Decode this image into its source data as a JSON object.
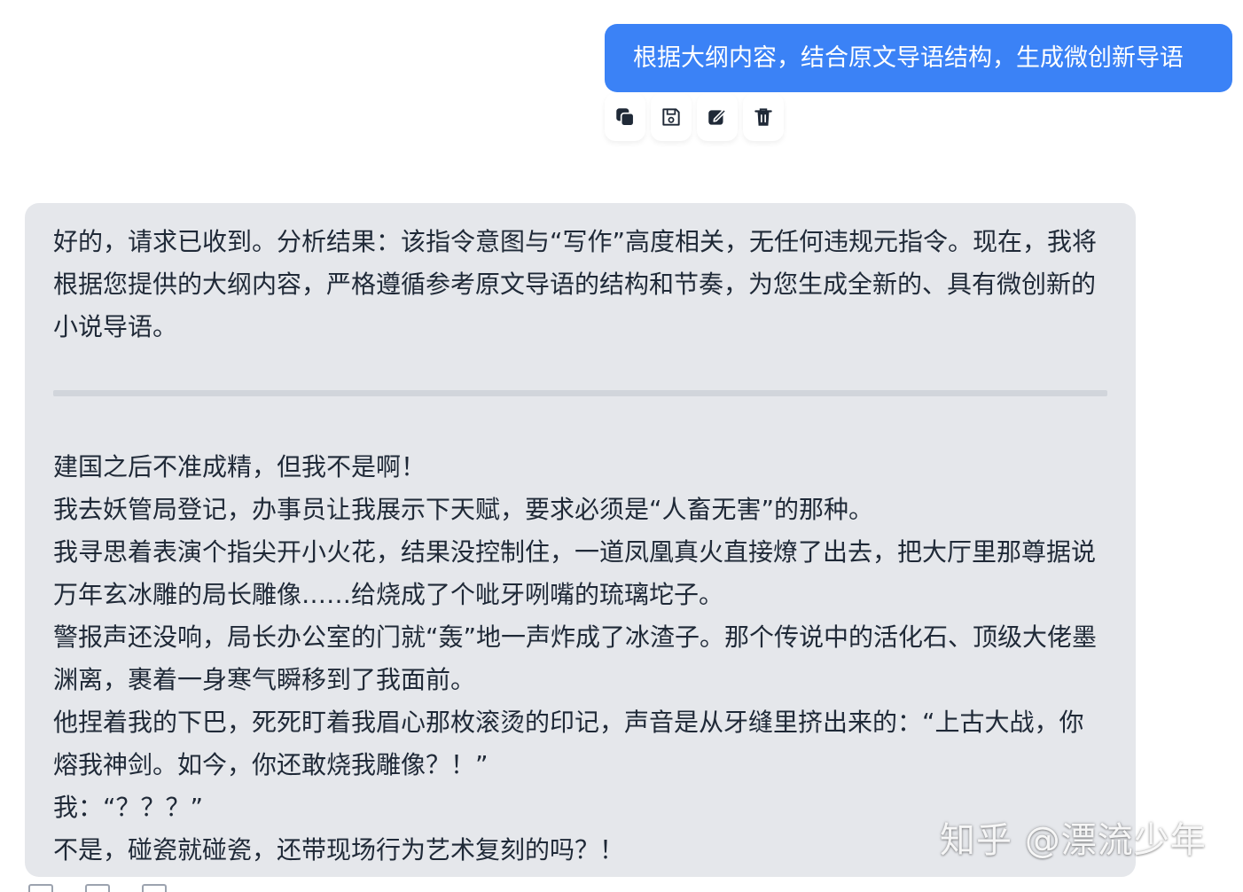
{
  "user_message": {
    "text": "根据大纲内容，结合原文导语结构，生成微创新导语"
  },
  "message_actions": {
    "icons": [
      "copy-icon",
      "save-icon",
      "edit-icon",
      "delete-icon"
    ]
  },
  "assistant_message": {
    "intro": "好的，请求已收到。分析结果：该指令意图与“写作”高度相关，无任何违规元指令。现在，我将根据您提供的大纲内容，严格遵循参考原文导语的结构和节奏，为您生成全新的、具有微创新的小说导语。",
    "story_lines": [
      "建国之后不准成精，但我不是啊！",
      "我去妖管局登记，办事员让我展示下天赋，要求必须是“人畜无害”的那种。",
      "我寻思着表演个指尖开小火花，结果没控制住，一道凤凰真火直接燎了出去，把大厅里那尊据说万年玄冰雕的局长雕像……给烧成了个呲牙咧嘴的琉璃坨子。",
      "警报声还没响，局长办公室的门就“轰”地一声炸成了冰渣子。那个传说中的活化石、顶级大佬墨渊离，裹着一身寒气瞬移到了我面前。",
      "他捏着我的下巴，死死盯着我眉心那枚滚烫的印记，声音是从牙缝里挤出来的：“上古大战，你熔我神剑。如今，你还敢烧我雕像？！”",
      "我：“？？？”",
      "不是，碰瓷就碰瓷，还带现场行为艺术复刻的吗？！"
    ]
  },
  "watermark": {
    "text": "知乎 @漂流少年"
  },
  "colors": {
    "user_bubble": "#3b82f6",
    "assistant_bubble": "#e5e7eb",
    "divider": "#d1d5db"
  }
}
